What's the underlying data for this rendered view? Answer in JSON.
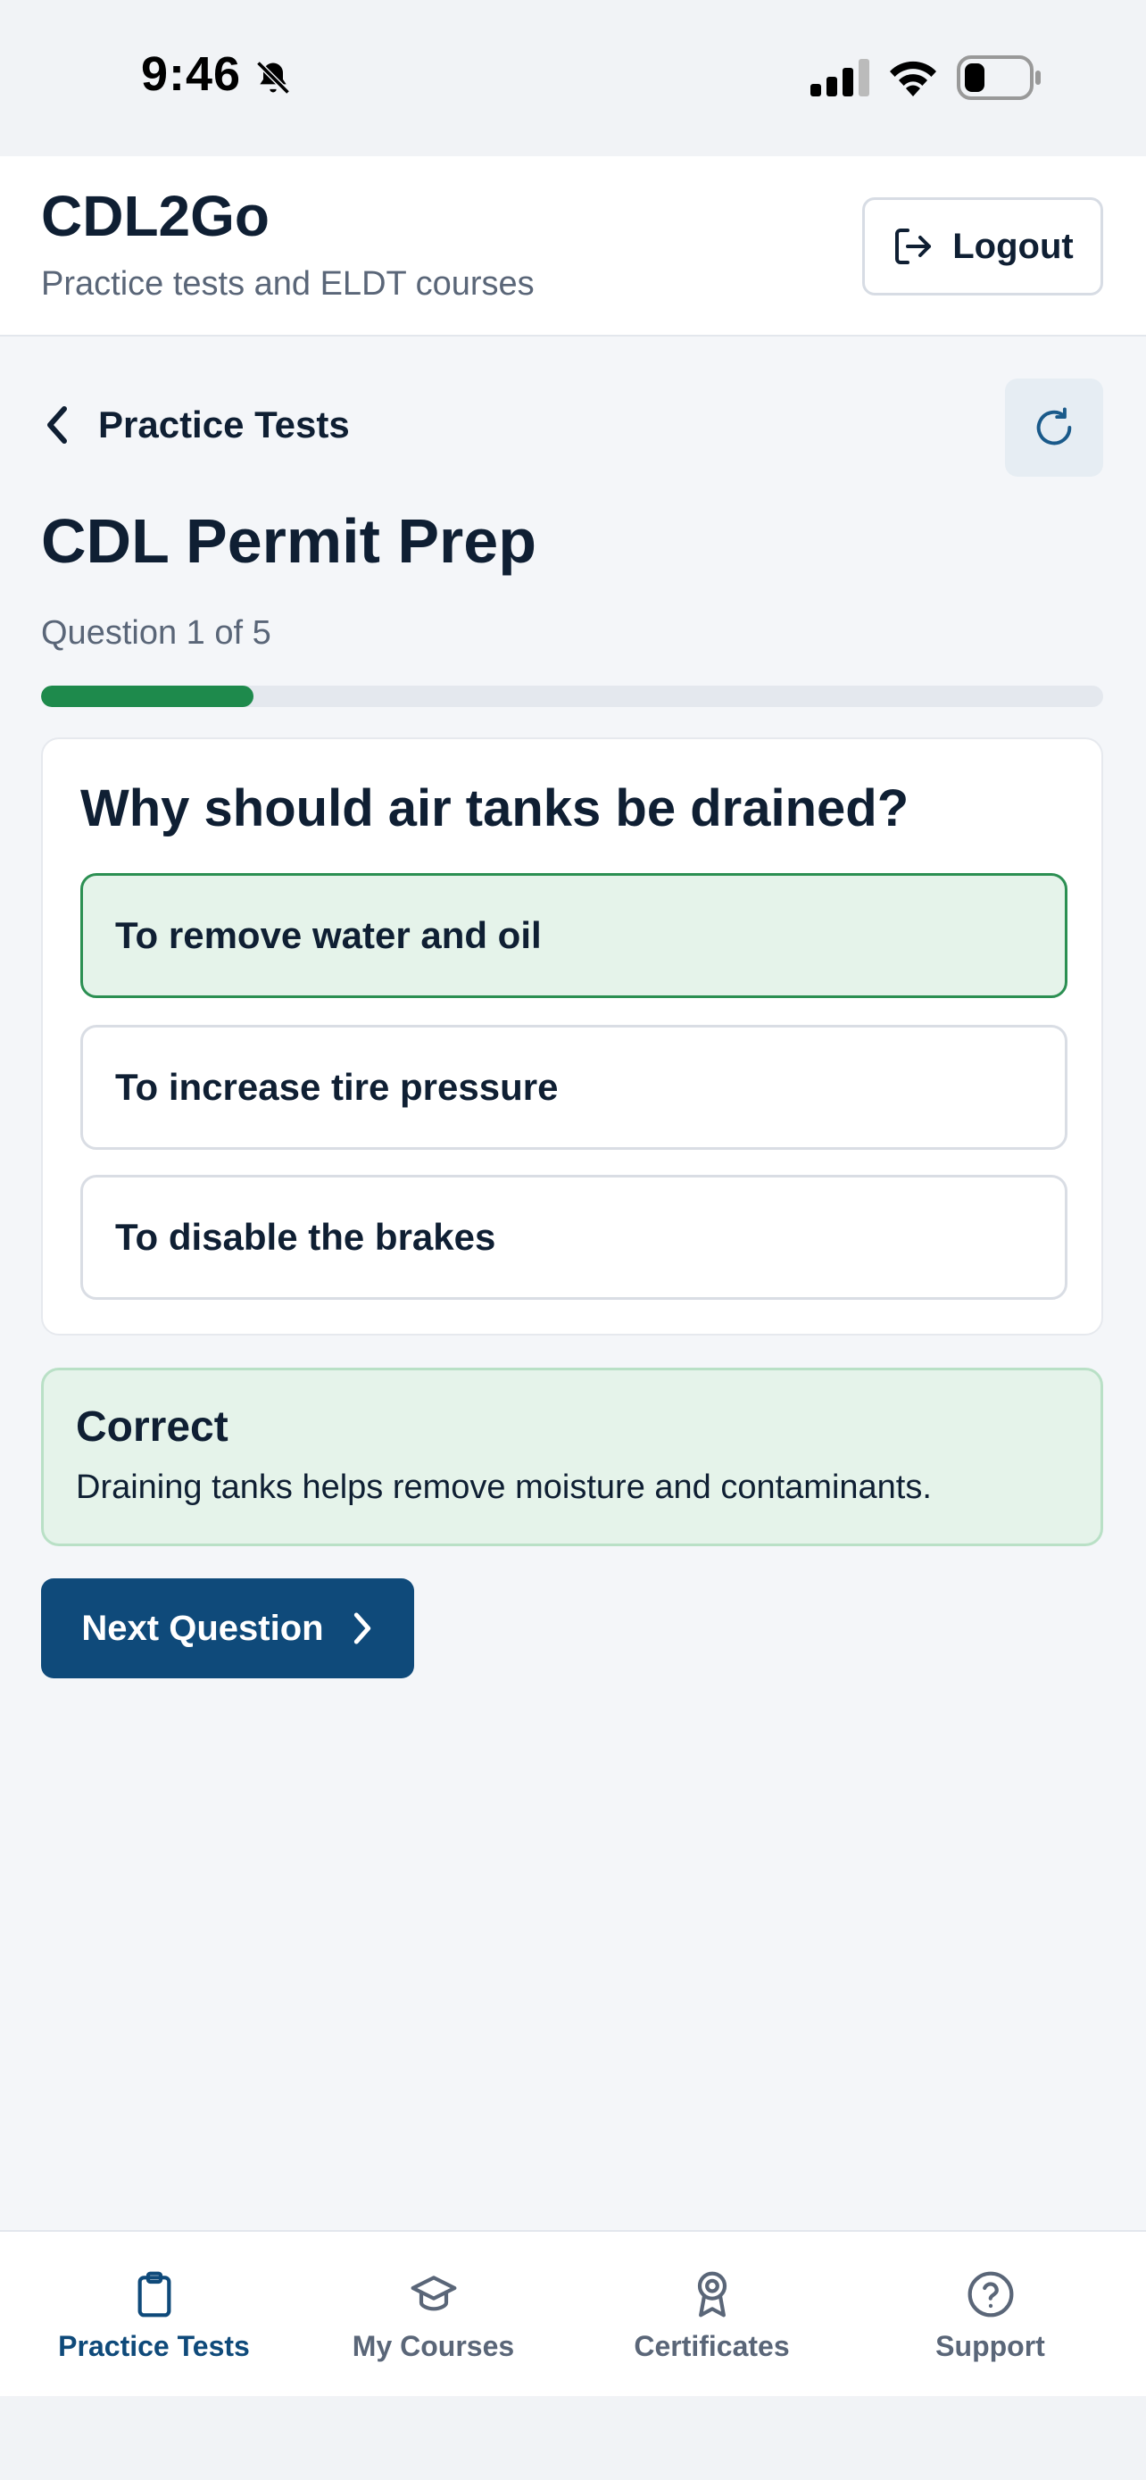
{
  "status_bar": {
    "time": "9:46",
    "icons": [
      "bell-slash-icon",
      "signal-icon",
      "wifi-icon",
      "battery-icon"
    ]
  },
  "header": {
    "title": "CDL2Go",
    "subtitle": "Practice tests and ELDT courses",
    "logout_label": "Logout"
  },
  "subnav": {
    "back_label": "Practice Tests",
    "refresh_icon": "refresh-icon"
  },
  "quiz": {
    "title": "CDL Permit Prep",
    "progress_text": "Question 1 of 5",
    "progress_fraction": 0.2,
    "question": "Why should air tanks be drained?",
    "options": [
      {
        "label": "To remove water and oil",
        "state": "correct"
      },
      {
        "label": "To increase tire pressure",
        "state": "default"
      },
      {
        "label": "To disable the brakes",
        "state": "default"
      }
    ],
    "feedback": {
      "title": "Correct",
      "text": "Draining tanks helps remove moisture and contaminants."
    },
    "next_label": "Next Question"
  },
  "tabs": [
    {
      "label": "Practice Tests",
      "icon": "clipboard-icon",
      "active": true
    },
    {
      "label": "My Courses",
      "icon": "graduation-cap-icon",
      "active": false
    },
    {
      "label": "Certificates",
      "icon": "award-icon",
      "active": false
    },
    {
      "label": "Support",
      "icon": "help-circle-icon",
      "active": false
    }
  ],
  "colors": {
    "primary": "#0f4a7a",
    "success": "#1e8a4c",
    "success_bg": "#e5f3ea",
    "background": "#f4f6f9"
  }
}
